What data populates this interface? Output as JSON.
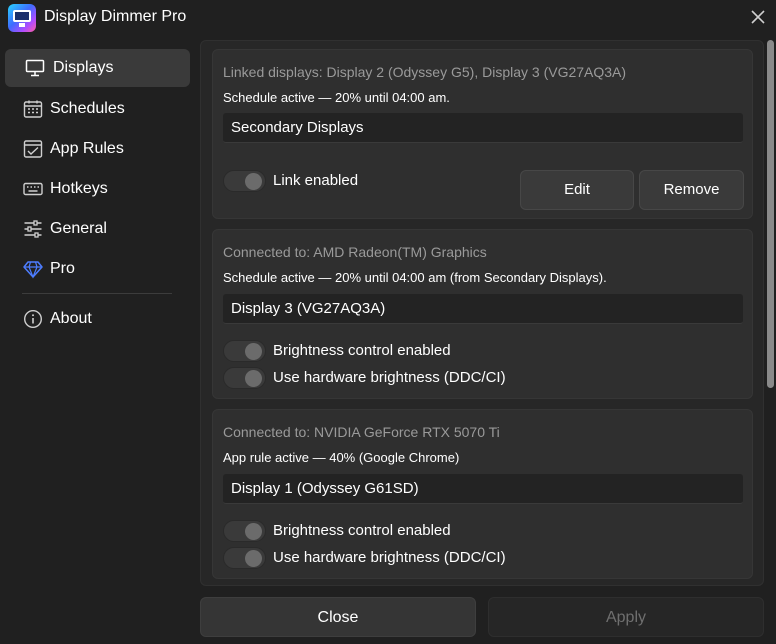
{
  "app": {
    "title": "Display Dimmer Pro"
  },
  "sidebar": {
    "items": [
      {
        "label": "Displays",
        "icon": "monitor-icon",
        "active": true
      },
      {
        "label": "Schedules",
        "icon": "calendar-icon",
        "active": false
      },
      {
        "label": "App Rules",
        "icon": "app-rules-icon",
        "active": false
      },
      {
        "label": "Hotkeys",
        "icon": "keyboard-icon",
        "active": false
      },
      {
        "label": "General",
        "icon": "sliders-icon",
        "active": false
      },
      {
        "label": "Pro",
        "icon": "diamond-icon",
        "active": false
      },
      {
        "label": "About",
        "icon": "info-icon",
        "active": false
      }
    ]
  },
  "cards": [
    {
      "subtitle": "Linked displays: Display 2 (Odyssey G5), Display 3 (VG27AQ3A)",
      "status": "Schedule active — 20% until 04:00 am.",
      "name": "Secondary Displays",
      "toggles": [
        {
          "label": "Link enabled",
          "on": false
        }
      ],
      "edit_label": "Edit",
      "remove_label": "Remove"
    },
    {
      "subtitle": "Connected to: AMD Radeon(TM) Graphics",
      "status": "Schedule active — 20% until 04:00 am (from Secondary Displays).",
      "name": "Display 3 (VG27AQ3A)",
      "toggles": [
        {
          "label": "Brightness control enabled",
          "on": false
        },
        {
          "label": "Use hardware brightness (DDC/CI)",
          "on": false
        }
      ]
    },
    {
      "subtitle": "Connected to: NVIDIA GeForce RTX 5070 Ti",
      "status": "App rule active — 40% (Google Chrome)",
      "name": "Display 1 (Odyssey G61SD)",
      "toggles": [
        {
          "label": "Brightness control enabled",
          "on": false
        },
        {
          "label": "Use hardware brightness (DDC/CI)",
          "on": false
        }
      ]
    }
  ],
  "footer": {
    "close_label": "Close",
    "apply_label": "Apply",
    "apply_enabled": false
  },
  "colors": {
    "background": "#202020",
    "card": "#2f2f2f",
    "accent_diamond": "#3b6cff"
  }
}
